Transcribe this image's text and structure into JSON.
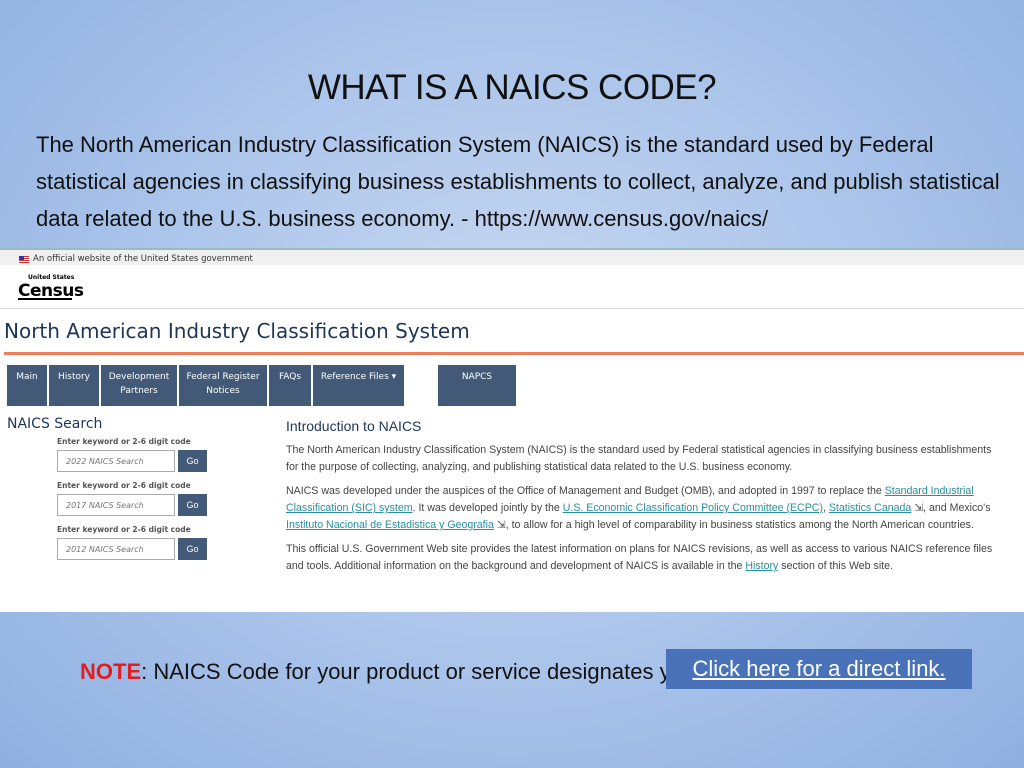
{
  "slide": {
    "title": "WHAT IS A NAICS CODE?",
    "intro": "The North American Industry Classification System (NAICS) is the standard used by Federal statistical agencies in classifying business establishments to collect, analyze, and publish statistical data related to the U.S. business economy.  -  https://www.census.gov/naics/",
    "note_label": "NOTE",
    "note_text": ": NAICS Code for your product or service designates your small business status.",
    "link_button": "Click here for a direct link.",
    "link_color": "#4a72b8"
  },
  "site": {
    "gov_banner": "An official website of the United States government",
    "logo_top": "United States",
    "logo_main": "Census",
    "logo_bottom": "Bureau",
    "heading": "North American Industry Classification System",
    "nav": [
      "Main",
      "History",
      "Development Partners",
      "Federal Register Notices",
      "FAQs",
      "Reference Files ▾",
      "NAPCS"
    ],
    "search_title": "NAICS Search",
    "searches": [
      {
        "label": "Enter keyword or 2-6 digit code",
        "placeholder": "2022 NAICS Search",
        "button": "Go"
      },
      {
        "label": "Enter keyword or 2-6 digit code",
        "placeholder": "2017 NAICS Search",
        "button": "Go"
      },
      {
        "label": "Enter keyword or 2-6 digit code",
        "placeholder": "2012 NAICS Search",
        "button": "Go"
      }
    ],
    "intro_title": "Introduction to NAICS",
    "p1": "The North American Industry Classification System (NAICS) is the standard used by Federal statistical agencies in classifying business establishments for the purpose of collecting, analyzing, and publishing statistical data related to the U.S. business economy.",
    "p2": {
      "t1": "NAICS was developed under the auspices of the Office of Management and Budget (OMB), and adopted in 1997 to replace the ",
      "l1": "Standard Industrial Classification (SIC) system",
      "t2": ". It was developed jointly by the ",
      "l2": "U.S. Economic Classification Policy Committee (ECPC)",
      "t3": ", ",
      "l3": "Statistics Canada",
      "t4": " ⇲, and Mexico's ",
      "l4": "Instituto Nacional de Estadistica y Geografia",
      "t5": " ⇲, to allow for a high level of comparability in business statistics among the North American countries."
    },
    "p3": {
      "t1": "This official U.S. Government Web site provides the latest information on plans for NAICS revisions, as well as access to various NAICS reference files and tools. Additional information on the background and development of NAICS is available in the ",
      "l1": "History",
      "t2": " section of this Web site."
    }
  }
}
